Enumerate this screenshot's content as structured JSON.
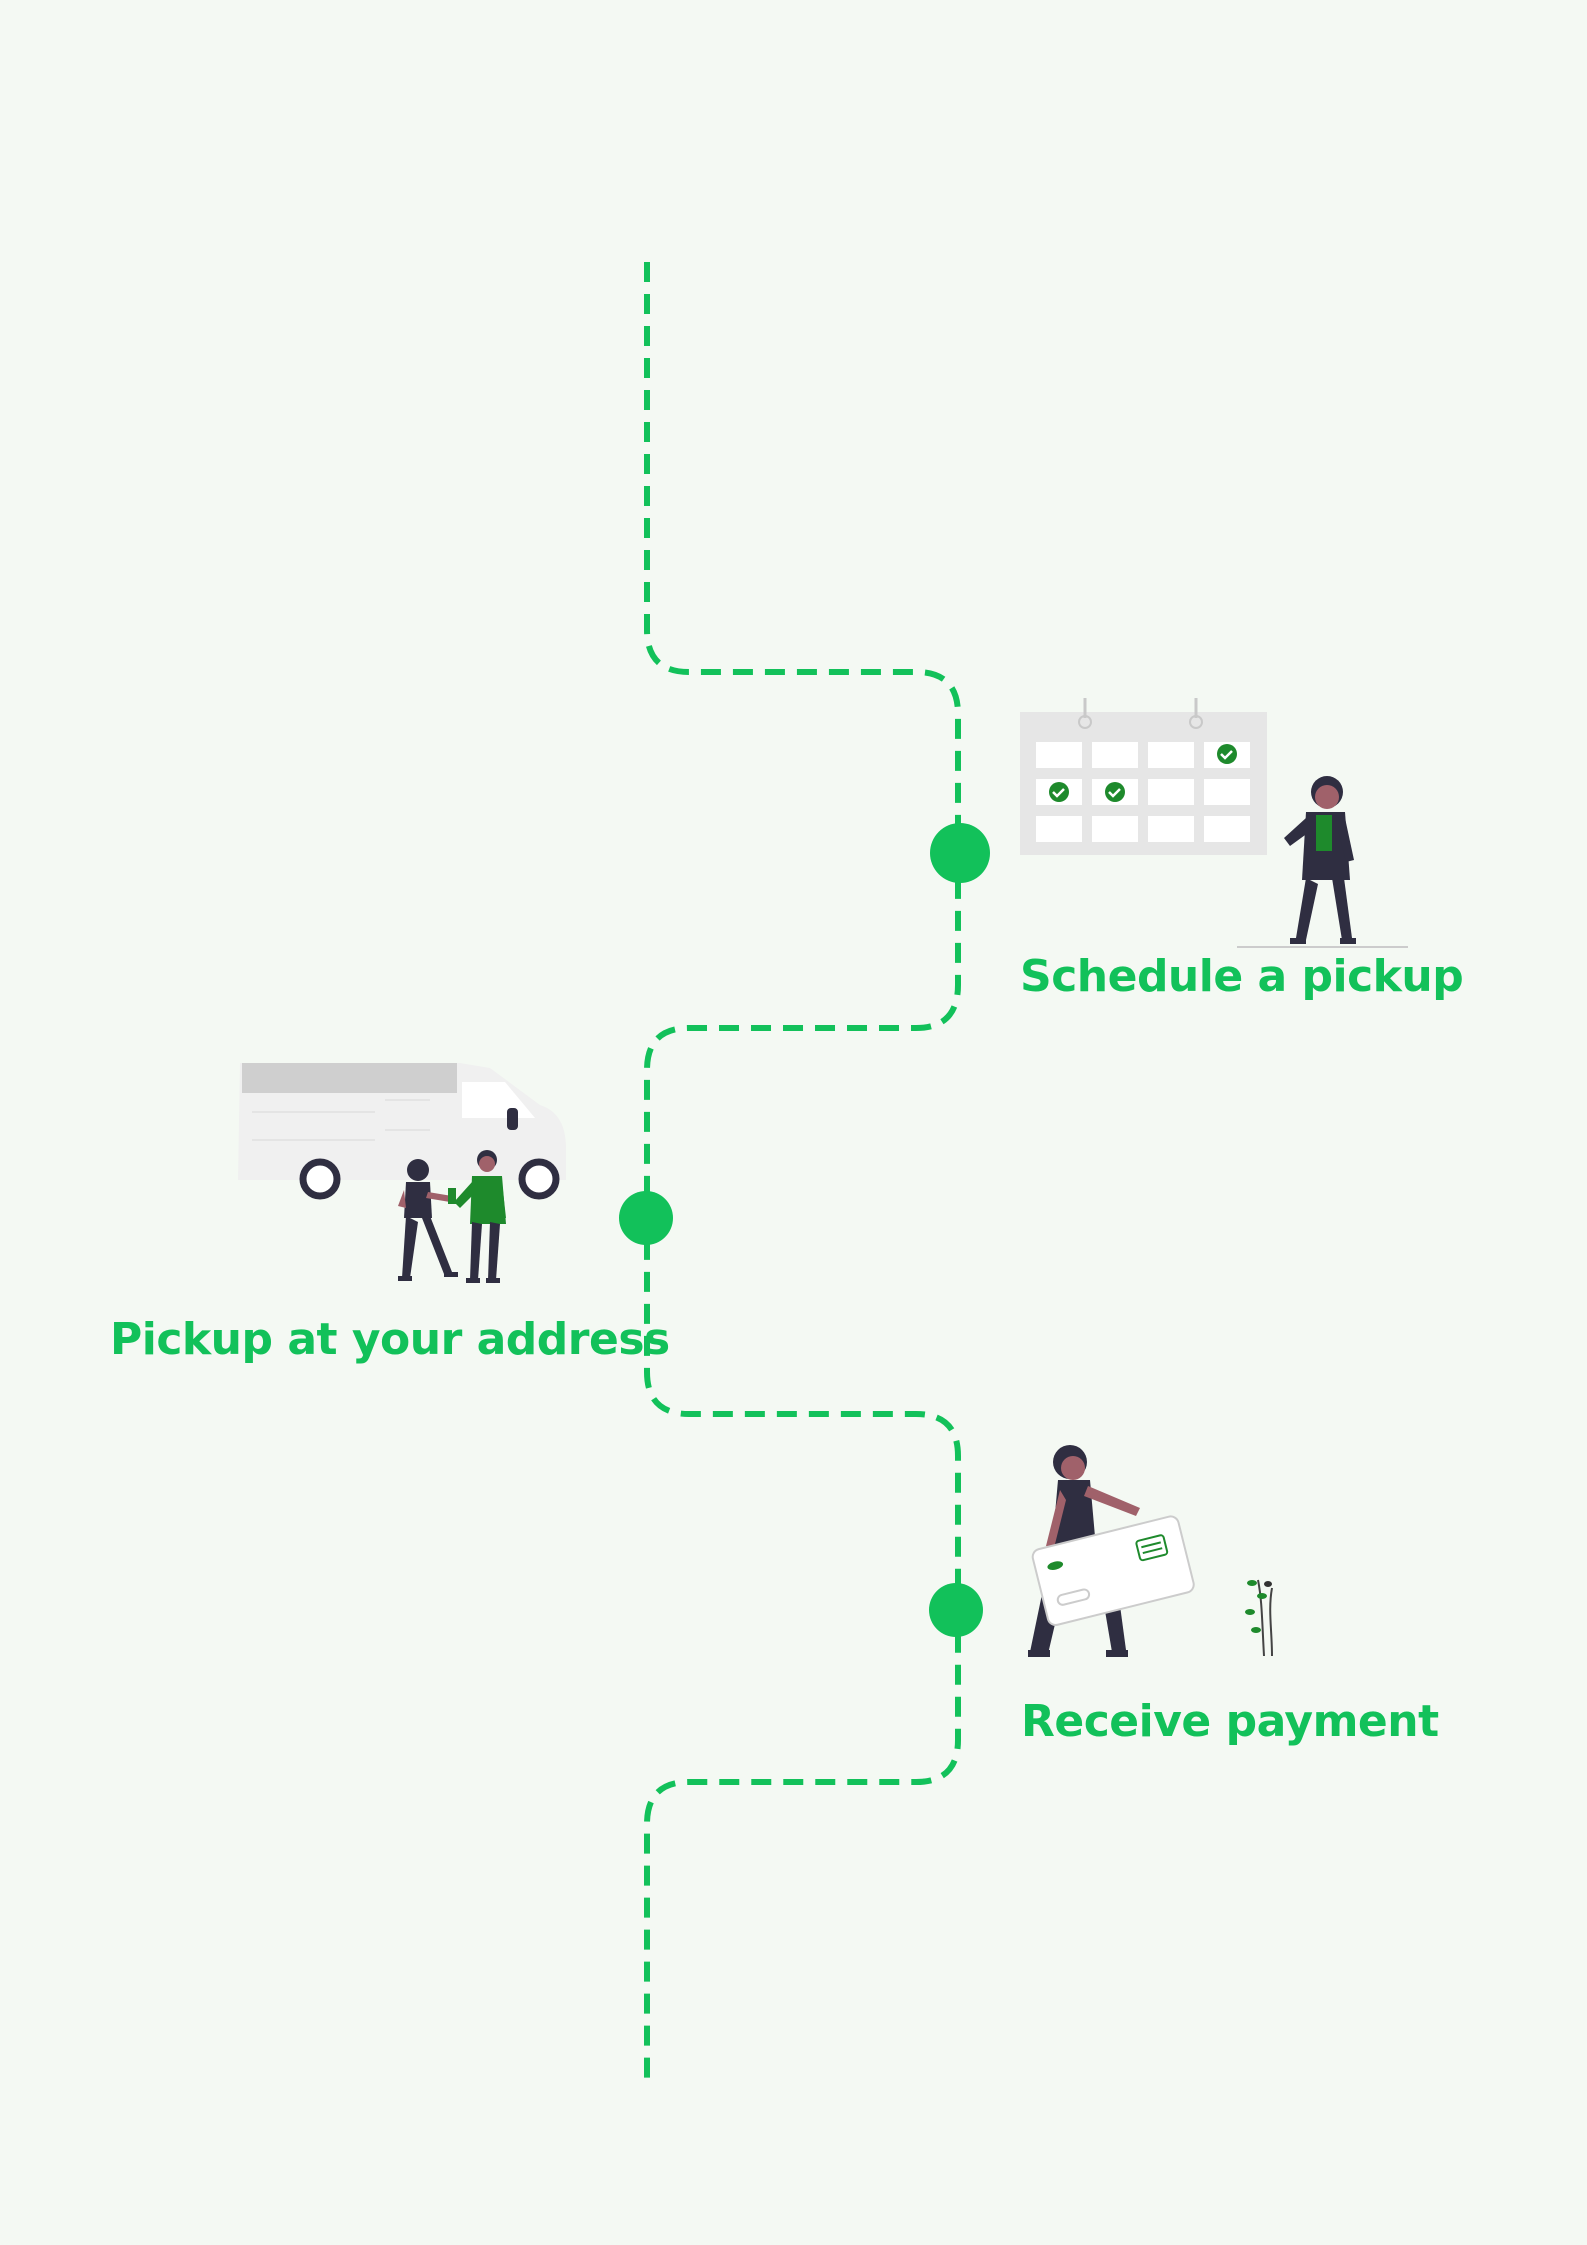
{
  "colors": {
    "background": "#f4f9f3",
    "accent": "#12c15a",
    "illustration_gray": "#e6e6e6",
    "illustration_dark": "#2f2e41",
    "illustration_green": "#1e8a2c",
    "skin": "#a0616a"
  },
  "steps": [
    {
      "label": "Schedule a pickup",
      "illustration": "calendar-person-icon"
    },
    {
      "label": "Pickup at your address",
      "illustration": "delivery-van-people-icon"
    },
    {
      "label": "Receive payment",
      "illustration": "person-holding-card-icon"
    }
  ]
}
